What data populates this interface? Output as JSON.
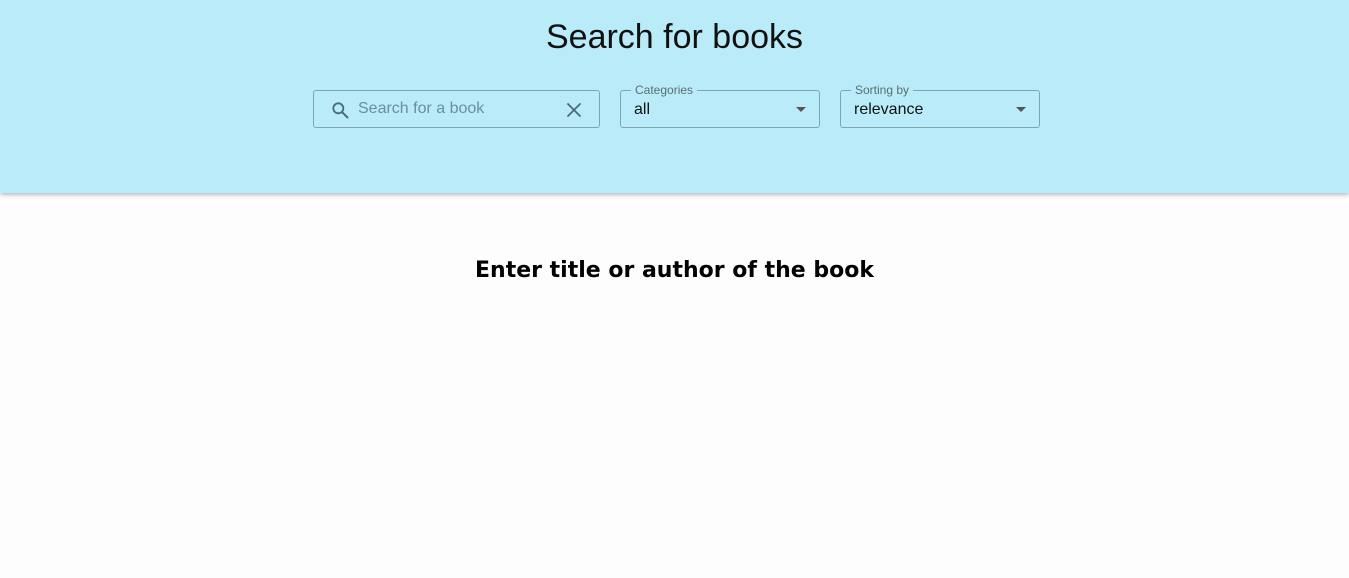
{
  "header": {
    "title": "Search for books"
  },
  "search": {
    "placeholder": "Search for a book",
    "value": "",
    "icon": "search-icon",
    "clear_icon": "close-icon"
  },
  "categories": {
    "label": "Categories",
    "selected": "all"
  },
  "sorting": {
    "label": "Sorting by",
    "selected": "relevance"
  },
  "main": {
    "message": "Enter title or author of the book"
  },
  "colors": {
    "header_background": "#b9ecf8",
    "page_background": "#fdfdfd"
  }
}
